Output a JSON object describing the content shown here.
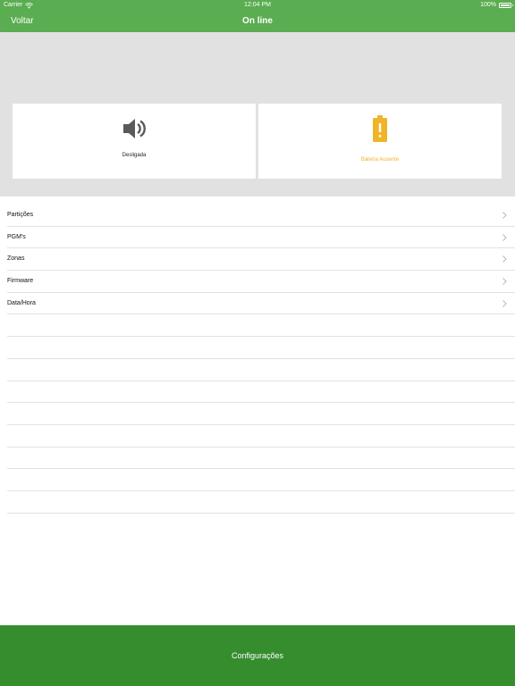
{
  "status_bar": {
    "carrier": "Carrier",
    "time": "12:04 PM",
    "battery_percent": "100%"
  },
  "navbar": {
    "back_label": "Voltar",
    "title": "On line"
  },
  "cards": {
    "siren": {
      "icon": "speaker-icon",
      "label": "Desligada"
    },
    "battery": {
      "icon": "battery-warning-icon",
      "label": "Bateria Ausente",
      "color": "#f0b429"
    }
  },
  "menu": {
    "items": [
      {
        "label": "Partições"
      },
      {
        "label": "PGM's"
      },
      {
        "label": "Zonas"
      },
      {
        "label": "Firmware"
      },
      {
        "label": "Data/Hora"
      }
    ]
  },
  "bottom_bar": {
    "label": "Configurações"
  },
  "colors": {
    "header": "#5aad50",
    "bottom_bar": "#368d2e",
    "panel_bg": "#e1e1e1",
    "warning": "#f0b429"
  }
}
